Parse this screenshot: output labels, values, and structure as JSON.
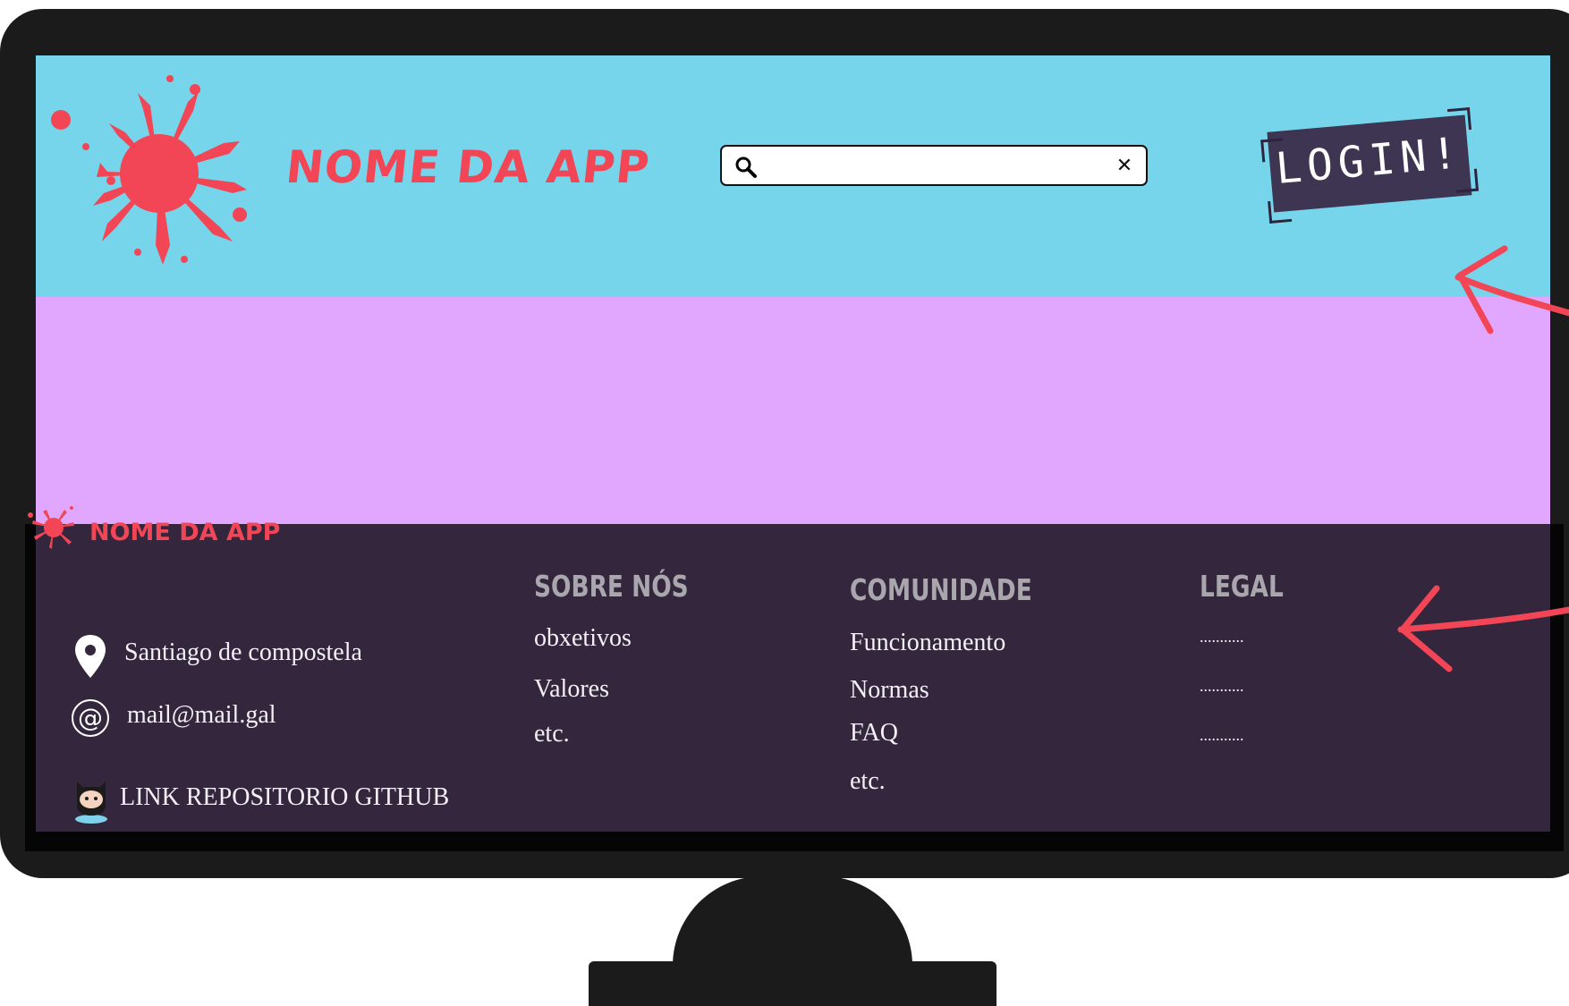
{
  "header": {
    "app_name": "NOME DA APP",
    "search": {
      "value": "",
      "placeholder": ""
    },
    "login_label": "LOGIN!"
  },
  "footer": {
    "app_name": "NOME DA APP",
    "location": "Santiago de compostela",
    "email": "mail@mail.gal",
    "github_link": "LINK REPOSITORIO GITHUB",
    "columns": [
      {
        "heading": "SOBRE NÓS",
        "links": [
          "obxetivos",
          "Valores",
          "etc."
        ]
      },
      {
        "heading": "COMUNIDADE",
        "links": [
          "Funcionamento",
          "Normas",
          "FAQ",
          "etc."
        ]
      },
      {
        "heading": "LEGAL",
        "links": [
          "...........",
          "...........",
          "..........."
        ]
      }
    ]
  },
  "icons": [
    "splat-logo-icon",
    "search-icon",
    "close-icon",
    "location-pin-icon",
    "at-sign-icon",
    "github-octocat-icon",
    "arrow-icon"
  ],
  "colors": {
    "header_bg": "#76d4eb",
    "body_bg": "#e1a6fd",
    "footer_bg": "#33263d",
    "brand": "#f24656",
    "login_bg": "#3e3552",
    "monitor": "#1b1b1b",
    "arrow": "#f24656"
  }
}
